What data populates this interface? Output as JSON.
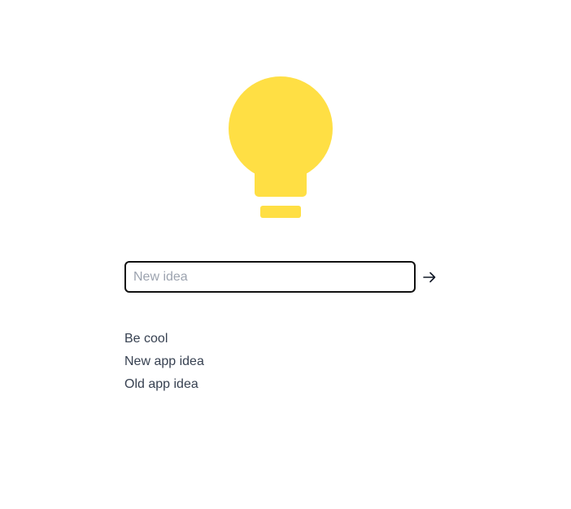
{
  "app": {
    "logo_icon": "lightbulb-icon",
    "accent_color": "#FFDF44"
  },
  "form": {
    "input_placeholder": "New idea",
    "input_value": "",
    "submit_icon": "arrow-right-icon"
  },
  "ideas": [
    {
      "label": "Be cool"
    },
    {
      "label": "New app idea"
    },
    {
      "label": "Old app idea"
    }
  ]
}
